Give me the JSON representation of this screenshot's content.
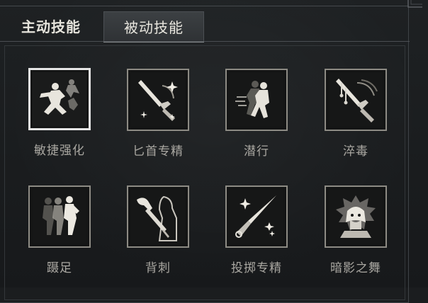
{
  "tabs": {
    "active_skills": "主动技能",
    "passive_skills": "被动技能"
  },
  "skills": [
    {
      "name": "敏捷强化",
      "icon": "leaping-figures-icon"
    },
    {
      "name": "匕首专精",
      "icon": "dagger-sparkle-icon"
    },
    {
      "name": "潜行",
      "icon": "sneaking-figure-icon"
    },
    {
      "name": "淬毒",
      "icon": "poisoned-blade-icon"
    },
    {
      "name": "蹑足",
      "icon": "tiptoe-figures-icon"
    },
    {
      "name": "背刺",
      "icon": "backstab-icon"
    },
    {
      "name": "投掷专精",
      "icon": "throwing-knife-icon"
    },
    {
      "name": "暗影之舞",
      "icon": "shadow-dance-icon"
    }
  ],
  "selected_skill": "敏捷强化",
  "colors": {
    "background": "#1b1d1f",
    "icon_border": "#8d8b84",
    "selected_border": "#e6e6e6",
    "label": "#a9a7a1"
  }
}
